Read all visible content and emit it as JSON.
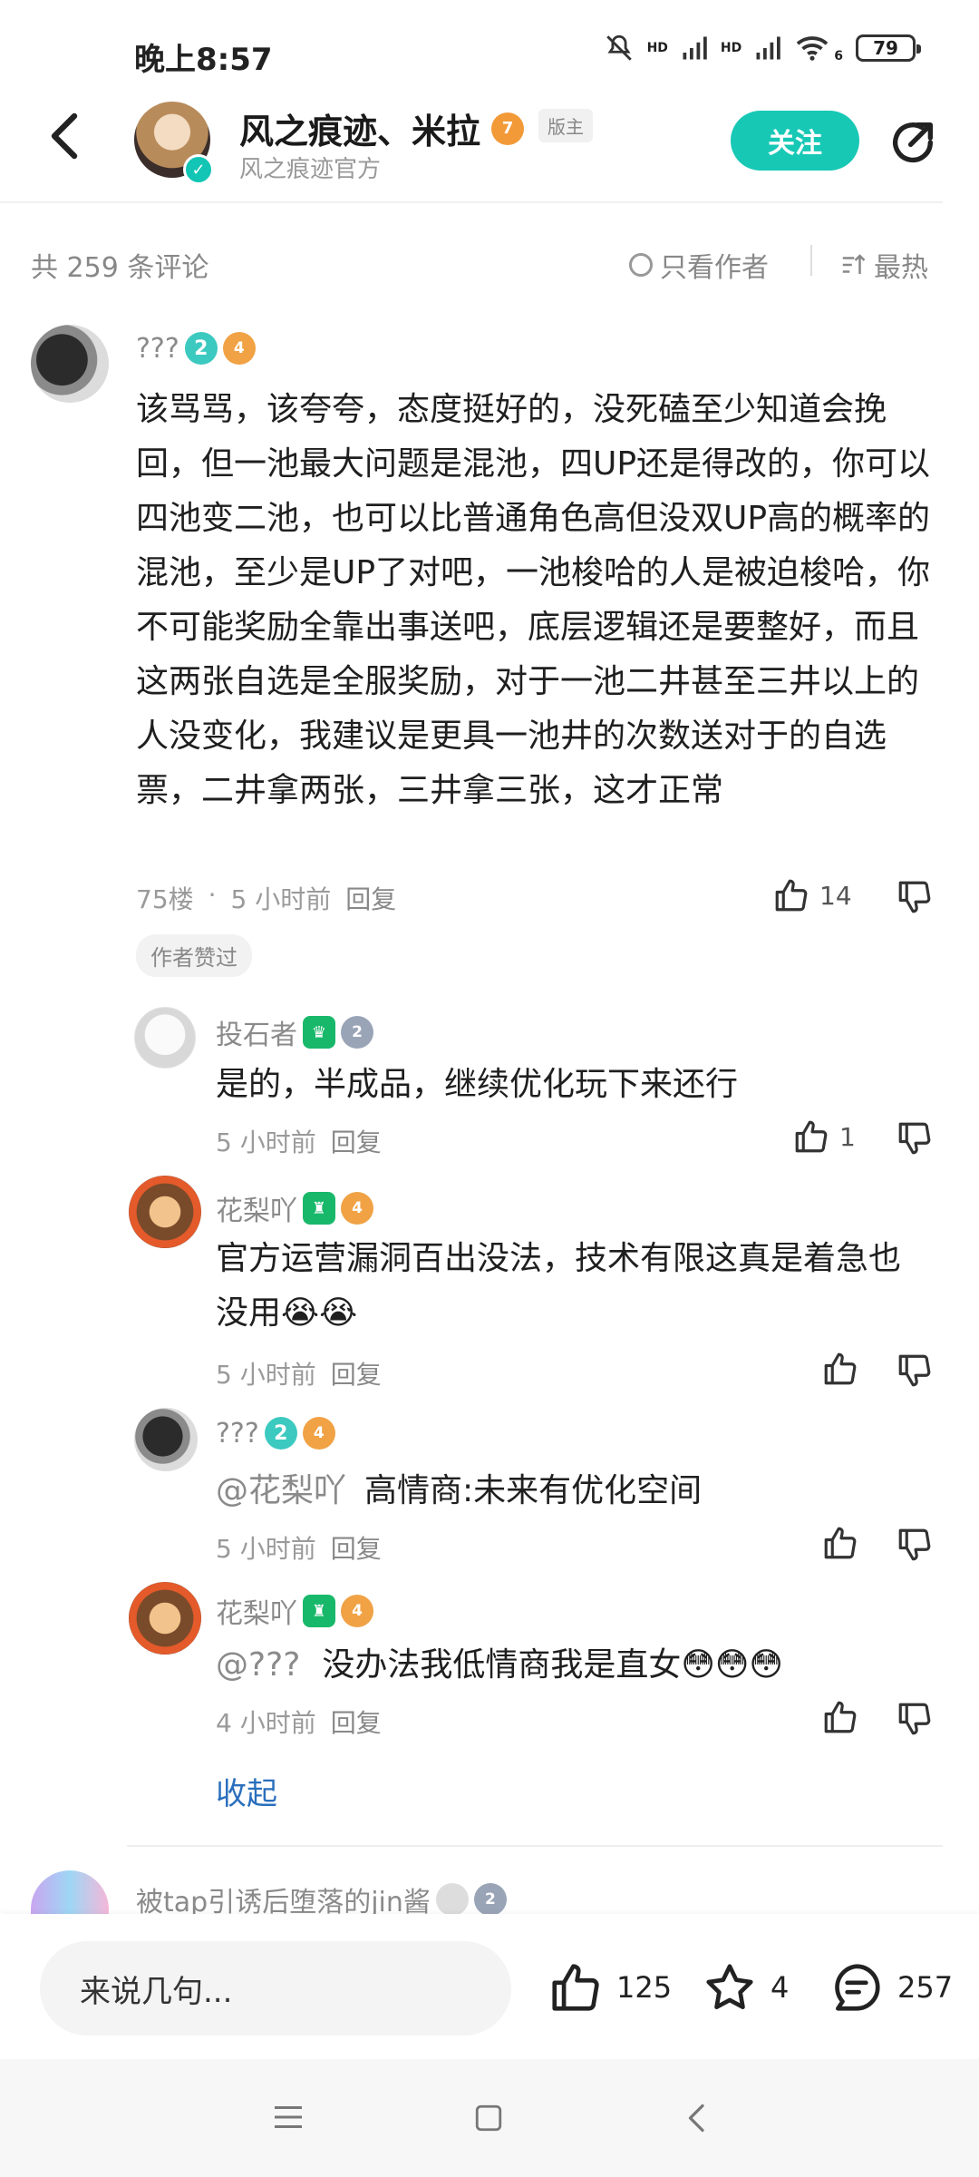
{
  "status_bar": {
    "time": "晚上8:57",
    "battery": "79",
    "net1": "HD",
    "net2": "HD",
    "wifi_num": "6"
  },
  "header": {
    "author_name": "风之痕迹、米拉",
    "level_badge": "7",
    "role_tag": "版主",
    "sub_title": "风之痕迹官方",
    "follow_label": "关注"
  },
  "comments_bar": {
    "count_text": "共 259 条评论",
    "filter_label": "只看作者",
    "sort_label": "最热"
  },
  "main_comment": {
    "user": "???",
    "level": "2",
    "badge": "4",
    "text": "该骂骂，该夸夸，态度挺好的，没死磕至少知道会挽回，但一池最大问题是混池，四UP还是得改的，你可以四池变二池，也可以比普通角色高但没双UP高的概率的混池，至少是UP了对吧，一池梭哈的人是被迫梭哈，你不可能奖励全靠出事送吧，底层逻辑还是要整好，而且这两张自选是全服奖励，对于一池二井甚至三井以上的人没变化，我建议是更具一池井的次数送对于的自选票，二井拿两张，三井拿三张，这才正常",
    "floor": "75楼",
    "dot": "·",
    "time": "5 小时前",
    "reply_label": "回复",
    "likes": "14",
    "liked_by_author": "作者赞过"
  },
  "replies": [
    {
      "user": "投石者",
      "badge": "2",
      "text": "是的，半成品，继续优化玩下来还行",
      "mention": "",
      "time": "5 小时前",
      "reply_label": "回复",
      "likes": "1"
    },
    {
      "user": "花梨吖",
      "badge": "4",
      "text": "官方运营漏洞百出没法，技术有限这真是着急也没用😭😭",
      "mention": "",
      "time": "5 小时前",
      "reply_label": "回复",
      "likes": ""
    },
    {
      "user": "???",
      "level": "2",
      "badge": "4",
      "text": "高情商:未来有优化空间",
      "mention": "@花梨吖",
      "time": "5 小时前",
      "reply_label": "回复",
      "likes": ""
    },
    {
      "user": "花梨吖",
      "badge": "4",
      "text": "没办法我低情商我是直女😳😳😳",
      "mention": "@???",
      "time": "4 小时前",
      "reply_label": "回复",
      "likes": ""
    }
  ],
  "collapse_label": "收起",
  "next_comment_user": "被tap引诱后堕落的jin酱",
  "next_comment_badge": "2",
  "bottom_bar": {
    "input_placeholder": "来说几句...",
    "likes": "125",
    "stars": "4",
    "comments": "257"
  },
  "colors": {
    "accent": "#17c8b5",
    "link": "#2a6fbd",
    "badge_orange": "#f0a245",
    "badge_green": "#18b86a"
  }
}
